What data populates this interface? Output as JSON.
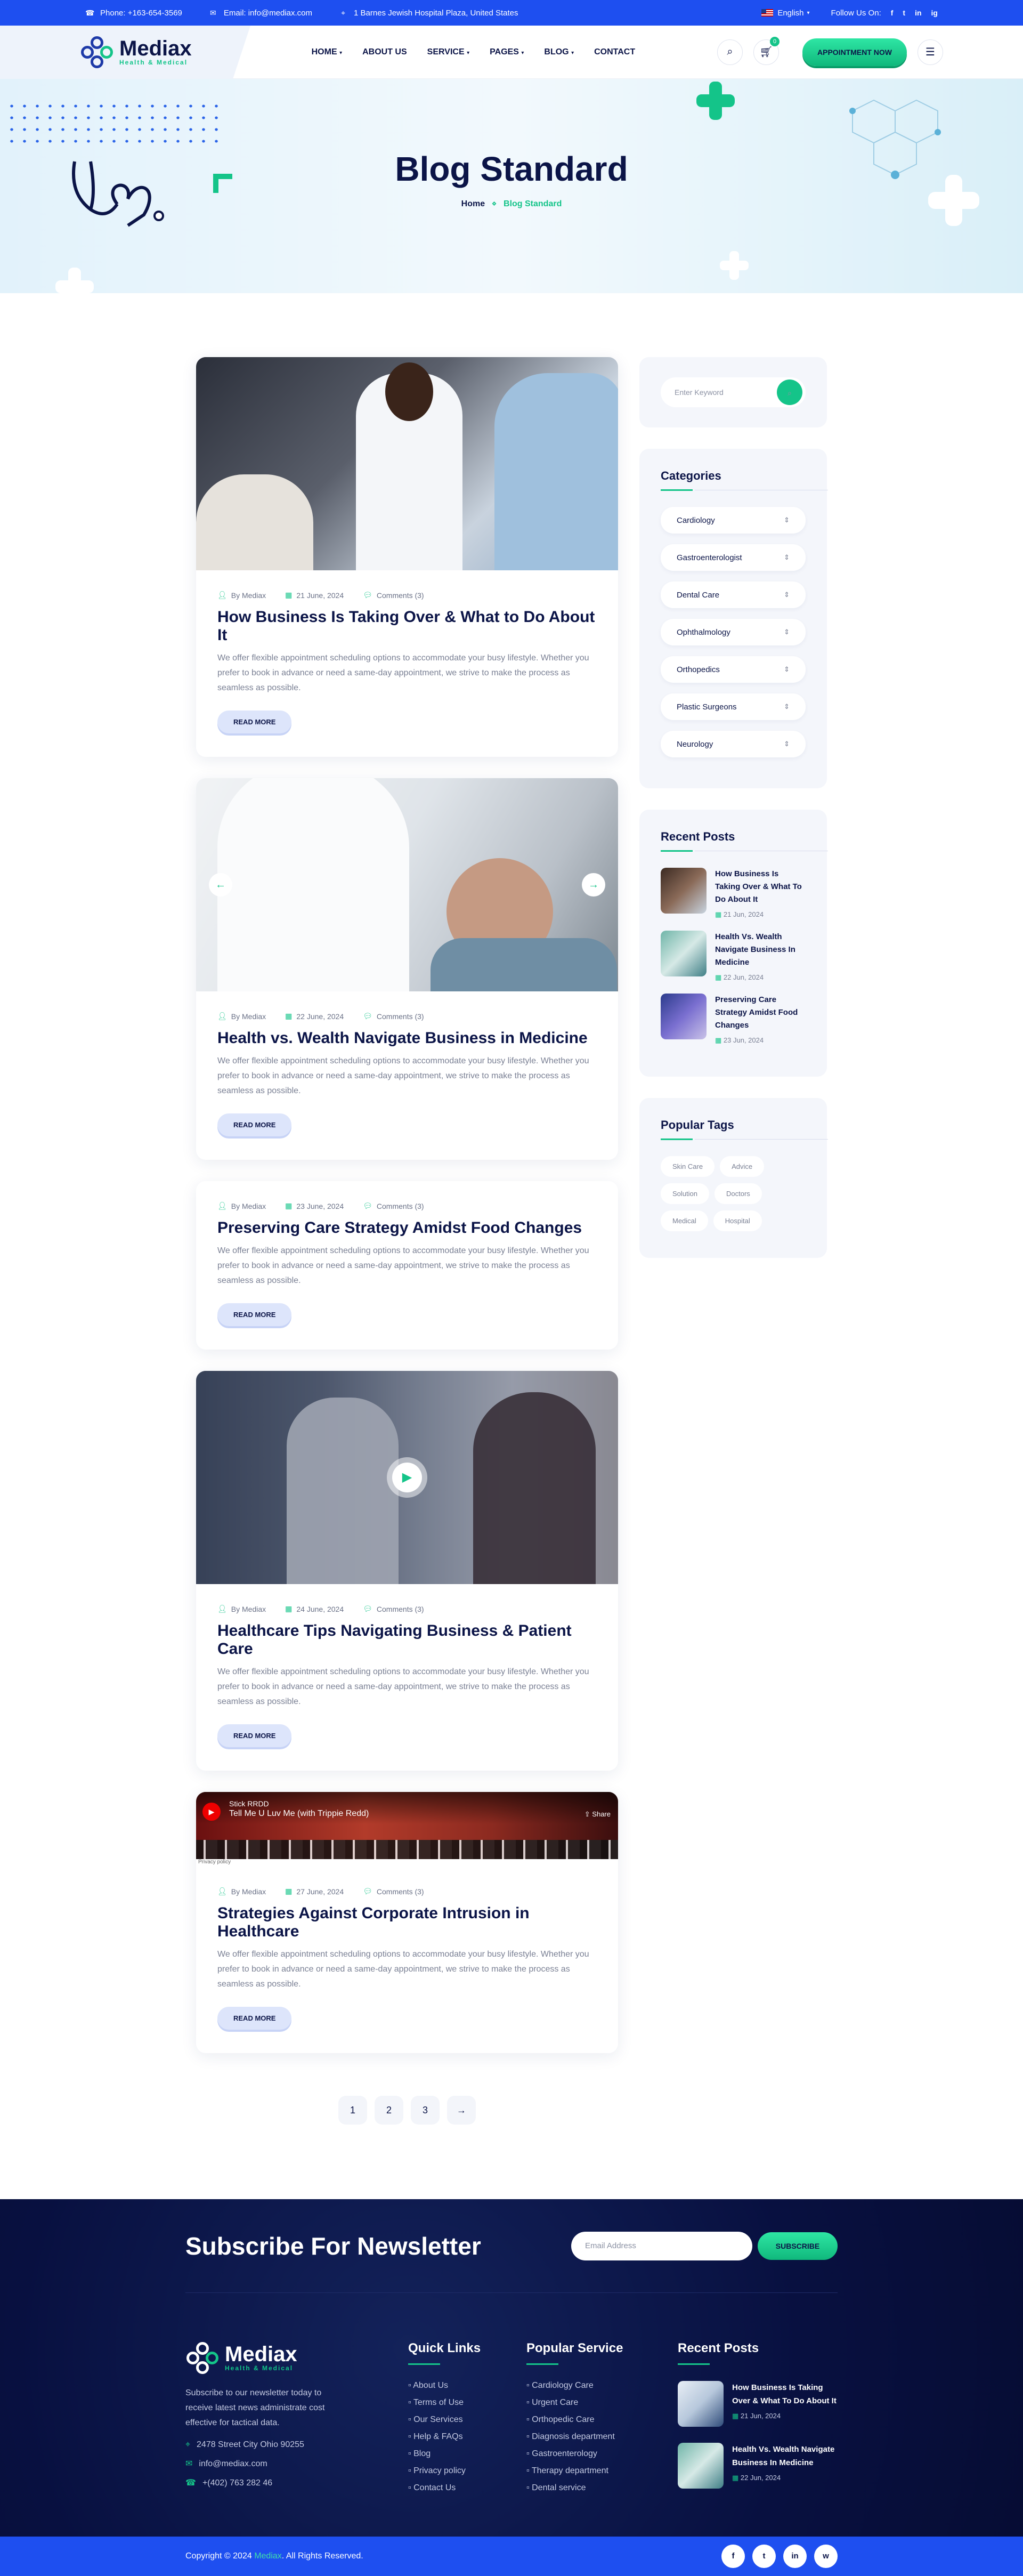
{
  "topbar": {
    "phone": "Phone: +163-654-3569",
    "email": "Email: info@mediax.com",
    "address": "1 Barnes Jewish Hospital Plaza, United States",
    "language": "English",
    "follow": "Follow Us On:",
    "socials": [
      "f",
      "t",
      "in",
      "ig"
    ]
  },
  "brand": {
    "name": "Mediax",
    "tagline": "Health & Medical"
  },
  "nav": {
    "items": [
      "HOME",
      "ABOUT US",
      "SERVICE",
      "PAGES",
      "BLOG",
      "CONTACT"
    ],
    "cart_count": "0",
    "appointment": "APPOINTMENT NOW"
  },
  "hero": {
    "title": "Blog Standard",
    "crumb_home": "Home",
    "crumb_current": "Blog Standard"
  },
  "posts": [
    {
      "author": "By Mediax",
      "date": "21 June, 2024",
      "comments": "Comments (3)",
      "title": "How Business Is Taking Over & What to Do About It",
      "excerpt": "We offer flexible appointment scheduling options to accommodate your busy lifestyle. Whether you prefer to book in advance or need a same-day appointment, we strive to make the process as seamless as possible.",
      "read_more": "READ MORE"
    },
    {
      "author": "By Mediax",
      "date": "22 June, 2024",
      "comments": "Comments (3)",
      "title": "Health vs. Wealth Navigate Business in Medicine",
      "excerpt": "We offer flexible appointment scheduling options to accommodate your busy lifestyle. Whether you prefer to book in advance or need a same-day appointment, we strive to make the process as seamless as possible.",
      "read_more": "READ MORE"
    },
    {
      "author": "By Mediax",
      "date": "23 June, 2024",
      "comments": "Comments (3)",
      "title": "Preserving Care Strategy Amidst Food Changes",
      "excerpt": "We offer flexible appointment scheduling options to accommodate your busy lifestyle. Whether you prefer to book in advance or need a same-day appointment, we strive to make the process as seamless as possible.",
      "read_more": "READ MORE"
    },
    {
      "author": "By Mediax",
      "date": "24 June, 2024",
      "comments": "Comments (3)",
      "title": "Healthcare Tips Navigating Business & Patient Care",
      "excerpt": "We offer flexible appointment scheduling options to accommodate your busy lifestyle. Whether you prefer to book in advance or need a same-day appointment, we strive to make the process as seamless as possible.",
      "read_more": "READ MORE"
    },
    {
      "author": "By Mediax",
      "date": "27 June, 2024",
      "comments": "Comments (3)",
      "title": "Strategies Against Corporate Intrusion in Healthcare",
      "excerpt": "We offer flexible appointment scheduling options to accommodate your busy lifestyle. Whether you prefer to book in advance or need a same-day appointment, we strive to make the process as seamless as possible.",
      "read_more": "READ MORE"
    }
  ],
  "video": {
    "channel": "Stick RRDD",
    "title": "Tell Me U Luv Me (with Trippie Redd)",
    "share": "Share",
    "privacy": "Privacy policy"
  },
  "pager": {
    "pages": [
      "1",
      "2",
      "3"
    ],
    "next": "→"
  },
  "sidebar": {
    "search_placeholder": "Enter Keyword",
    "categories_title": "Categories",
    "categories": [
      "Cardiology",
      "Gastroenterologist",
      "Dental Care",
      "Ophthalmology",
      "Orthopedics",
      "Plastic Surgeons",
      "Neurology"
    ],
    "recent_title": "Recent Posts",
    "recent": [
      {
        "title": "How Business Is Taking Over & What To Do About It",
        "date": "21 Jun, 2024"
      },
      {
        "title": "Health Vs. Wealth Navigate Business In Medicine",
        "date": "22 Jun, 2024"
      },
      {
        "title": "Preserving Care Strategy Amidst Food Changes",
        "date": "23 Jun, 2024"
      }
    ],
    "tags_title": "Popular Tags",
    "tags": [
      "Skin Care",
      "Advice",
      "Solution",
      "Doctors",
      "Medical",
      "Hospital"
    ]
  },
  "footer": {
    "newsletter_title": "Subscribe For Newsletter",
    "email_placeholder": "Email Address",
    "subscribe": "SUBSCRIBE",
    "about": "Subscribe to our newsletter today to receive latest news administrate cost effective for tactical data.",
    "address": "2478 Street City Ohio 90255",
    "email": "info@mediax.com",
    "phone": "+(402) 763 282 46",
    "links_title": "Quick Links",
    "links": [
      "About Us",
      "Terms of Use",
      "Our Services",
      "Help & FAQs",
      "Blog",
      "Privacy policy",
      "Contact Us"
    ],
    "services_title": "Popular Service",
    "services": [
      "Cardiology Care",
      "Urgent Care",
      "Orthopedic Care",
      "Diagnosis department",
      "Gastroenterology",
      "Therapy department",
      "Dental service"
    ],
    "recent_title": "Recent Posts",
    "recent": [
      {
        "title": "How Business Is Taking Over & What To Do About It",
        "date": "21 Jun, 2024"
      },
      {
        "title": "Health Vs. Wealth Navigate Business In Medicine",
        "date": "22 Jun, 2024"
      }
    ],
    "copy_pre": "Copyright © 2024 ",
    "copy_brand": "Mediax",
    "copy_post": ". All Rights Reserved.",
    "socials": [
      "f",
      "t",
      "in",
      "w"
    ]
  }
}
